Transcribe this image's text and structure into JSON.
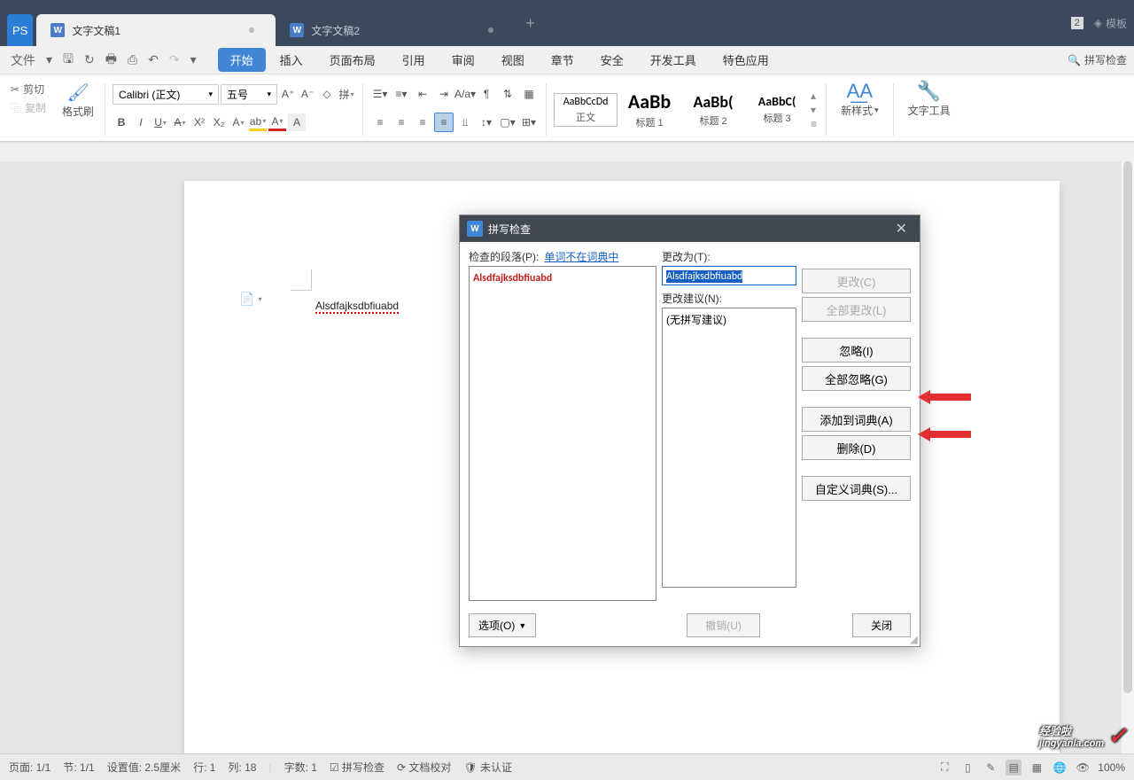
{
  "titlebar": {
    "logo": "PS",
    "tab1": "文字文稿1",
    "tab2": "文字文稿2",
    "badge": "2",
    "template": "模板"
  },
  "menubar": {
    "file": "文件",
    "items": [
      "开始",
      "插入",
      "页面布局",
      "引用",
      "审阅",
      "视图",
      "章节",
      "安全",
      "开发工具",
      "特色应用"
    ],
    "search": "拼写检查"
  },
  "ribbon": {
    "cut": "剪切",
    "copy": "复制",
    "format_brush": "格式刷",
    "font": "Calibri (正文)",
    "size": "五号",
    "style_normal_sample": "AaBbCcDd",
    "style_normal": "正文",
    "style_h1_sample": "AaBb",
    "style_h1": "标题 1",
    "style_h2_sample": "AaBb(",
    "style_h2": "标题 2",
    "style_h3_sample": "AaBbC(",
    "style_h3": "标题 3",
    "newstyle": "新样式",
    "texttool": "文字工具"
  },
  "doc": {
    "text": "Alsdfajksdbfiuabd"
  },
  "dialog": {
    "title": "拼写检查",
    "col1_label": "检查的段落(P):",
    "col1_link": "单词不在词典中",
    "col1_word": "Alsdfajksdbfiuabd",
    "col2_label": "更改为(T):",
    "col2_value": "Alsdfajksdbfiuabd",
    "col2_suggest_label": "更改建议(N):",
    "col2_suggest": "(无拼写建议)",
    "btn_change": "更改(C)",
    "btn_change_all": "全部更改(L)",
    "btn_ignore": "忽略(I)",
    "btn_ignore_all": "全部忽略(G)",
    "btn_add": "添加到词典(A)",
    "btn_delete": "删除(D)",
    "btn_custom": "自定义词典(S)...",
    "btn_options": "选项(O)",
    "btn_undo": "撤销(U)",
    "btn_close": "关闭"
  },
  "status": {
    "page": "页面: 1/1",
    "section": "节: 1/1",
    "setting": "设置值: 2.5厘米",
    "row": "行: 1",
    "col": "列: 18",
    "words": "字数: 1",
    "spell": "拼写检查",
    "proof": "文档校对",
    "cert": "未认证",
    "zoom": "100%"
  },
  "watermark": {
    "brand": "经验啦",
    "domain": "jingyanla.com"
  }
}
